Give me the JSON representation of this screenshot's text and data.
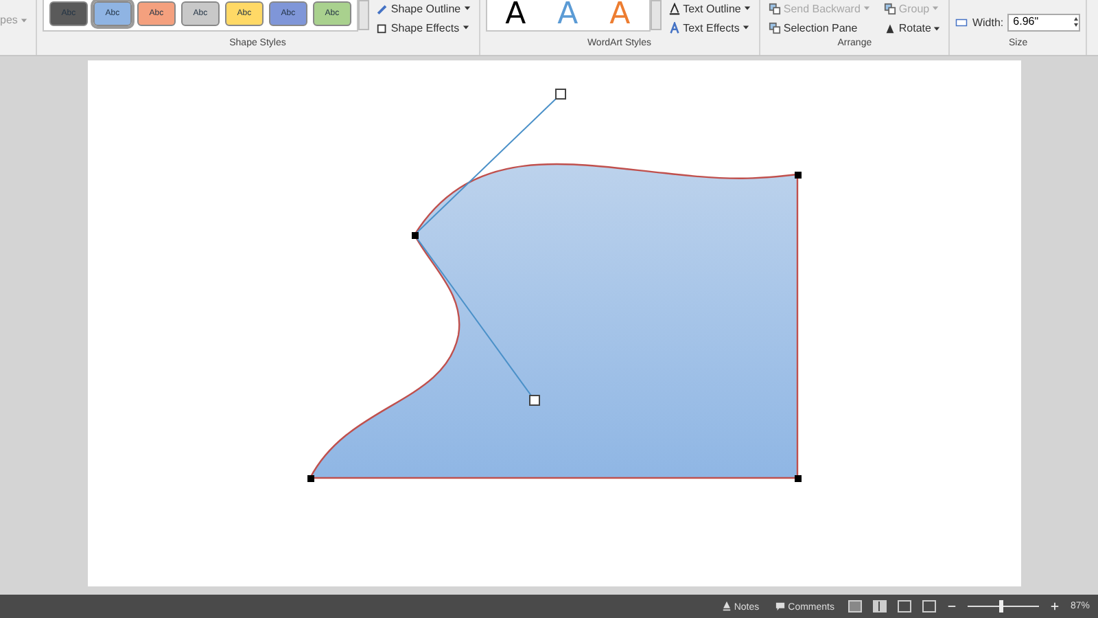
{
  "ribbon": {
    "shapes_menu": "pes",
    "groups": [
      {
        "kind": "styles",
        "label": "Shape Styles",
        "swatches": [
          {
            "text": "Abc",
            "color": "#5a5a5a",
            "selected": false
          },
          {
            "text": "Abc",
            "color": "#8fb4e3",
            "selected": true
          },
          {
            "text": "Abc",
            "color": "#f4a07e",
            "selected": false
          },
          {
            "text": "Abc",
            "color": "#c8c8c8",
            "selected": false
          },
          {
            "text": "Abc",
            "color": "#ffd966",
            "selected": false
          },
          {
            "text": "Abc",
            "color": "#7f96d8",
            "selected": false
          },
          {
            "text": "Abc",
            "color": "#a9d18e",
            "selected": false
          }
        ],
        "commands": [
          {
            "label": "Shape Outline",
            "dropdown": true,
            "disabled": false
          },
          {
            "label": "Shape Effects",
            "dropdown": true,
            "disabled": false
          }
        ]
      },
      {
        "kind": "wordart",
        "label": "WordArt Styles",
        "letters": [
          {
            "text": "A",
            "color": "#000000"
          },
          {
            "text": "A",
            "color": "#5b9bd5"
          },
          {
            "text": "A",
            "color": "#ed7d31"
          }
        ],
        "commands": [
          {
            "label": "Text Outline",
            "dropdown": true,
            "disabled": false
          },
          {
            "label": "Text Effects",
            "dropdown": true,
            "disabled": false
          }
        ]
      },
      {
        "kind": "arrange",
        "label": "Arrange",
        "commands": [
          {
            "label": "Send Backward",
            "dropdown": true,
            "disabled": true
          },
          {
            "label": "Group",
            "dropdown": true,
            "disabled": true
          },
          {
            "label": "Selection Pane",
            "dropdown": false,
            "disabled": false
          },
          {
            "label": "Rotate",
            "dropdown": true,
            "disabled": false
          }
        ]
      },
      {
        "kind": "size",
        "label": "Size",
        "field_label": "Width:",
        "value": "6.96\""
      }
    ]
  },
  "status_bar": {
    "notes": "Notes",
    "comments": "Comments",
    "zoom": {
      "level": 0.46,
      "reading": "87%"
    }
  }
}
